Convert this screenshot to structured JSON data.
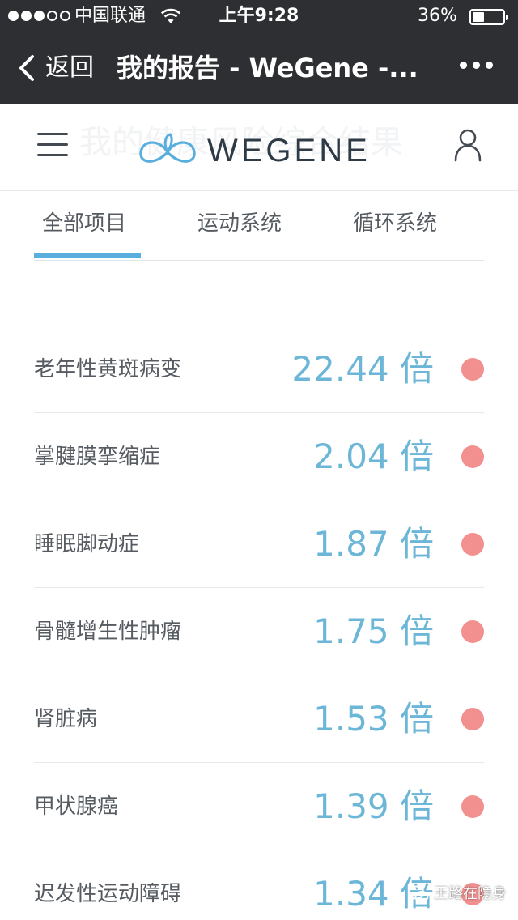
{
  "status_bar": {
    "carrier": "中国联通",
    "time": "上午9:28",
    "battery": "36%",
    "battery_level": 0.36,
    "signal_bars_filled": 3,
    "signal_bars_total": 5
  },
  "nav_bar": {
    "back_label": "返回",
    "title": "我的报告 - WeGene -..."
  },
  "site_header": {
    "brand": "WEGENE",
    "background_title": "我的健康风险综合结果"
  },
  "tabs": [
    {
      "label": "全部项目",
      "active": true
    },
    {
      "label": "运动系统",
      "active": false
    },
    {
      "label": "循环系统",
      "active": false
    }
  ],
  "risk_items": [
    {
      "name": "老年性黄斑病变",
      "value": "22.44 倍"
    },
    {
      "name": "掌腱膜挛缩症",
      "value": "2.04 倍"
    },
    {
      "name": "睡眠脚动症",
      "value": "1.87 倍"
    },
    {
      "name": "骨髓增生性肿瘤",
      "value": "1.75 倍"
    },
    {
      "name": "肾脏病",
      "value": "1.53 倍"
    },
    {
      "name": "甲状腺癌",
      "value": "1.39 倍"
    },
    {
      "name": "迟发性运动障碍",
      "value": "1.34 倍"
    }
  ],
  "watermark": {
    "text": "王路在隐身"
  },
  "colors": {
    "dark_bar": "#2e2f33",
    "accent_blue": "#5aaedd",
    "value_blue": "#6cb6d8",
    "risk_dot": "#f28f8f",
    "text_gray": "#555b61"
  }
}
